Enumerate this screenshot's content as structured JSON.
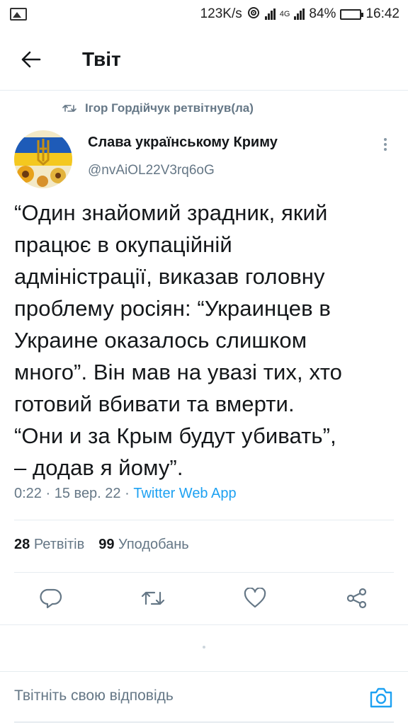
{
  "status_bar": {
    "speed": "123K/s",
    "network_type": "4G",
    "battery": "84%",
    "battery_level": 0.84,
    "time": "16:42"
  },
  "header": {
    "title": "Твіт"
  },
  "retweet": {
    "text": "Ігор Гордійчук ретвітнув(ла)"
  },
  "author": {
    "name": "Слава українському Криму",
    "handle": "@nvAiOL22V3rq6oG"
  },
  "tweet": {
    "lines": [
      "“Один знайомий зрадник, який",
      "працює в окупаційній",
      "адміністрації, виказав головну",
      "проблему росіян: “Украинцев в",
      "Украине оказалось слишком",
      "много”. Він мав на увазі тих, хто",
      "готовий вбивати та вмерти.",
      "“Они и за Крым будут убивать”,",
      "– додав я йому”."
    ],
    "time": "0:22",
    "date": "15 вер. 22",
    "separator": "·",
    "source": "Twitter Web App"
  },
  "stats": {
    "retweets_count": "28",
    "retweets_label": "Ретвітів",
    "likes_count": "99",
    "likes_label": "Уподобань"
  },
  "actions": {
    "reply_icon": "reply-icon",
    "retweet_icon": "retweet-icon",
    "like_icon": "heart-icon",
    "share_icon": "share-icon"
  },
  "reply_bar": {
    "placeholder": "Твітніть свою відповідь"
  },
  "colors": {
    "accent": "#1da1f2",
    "secondary_text": "#657786",
    "primary_text": "#14171a"
  }
}
